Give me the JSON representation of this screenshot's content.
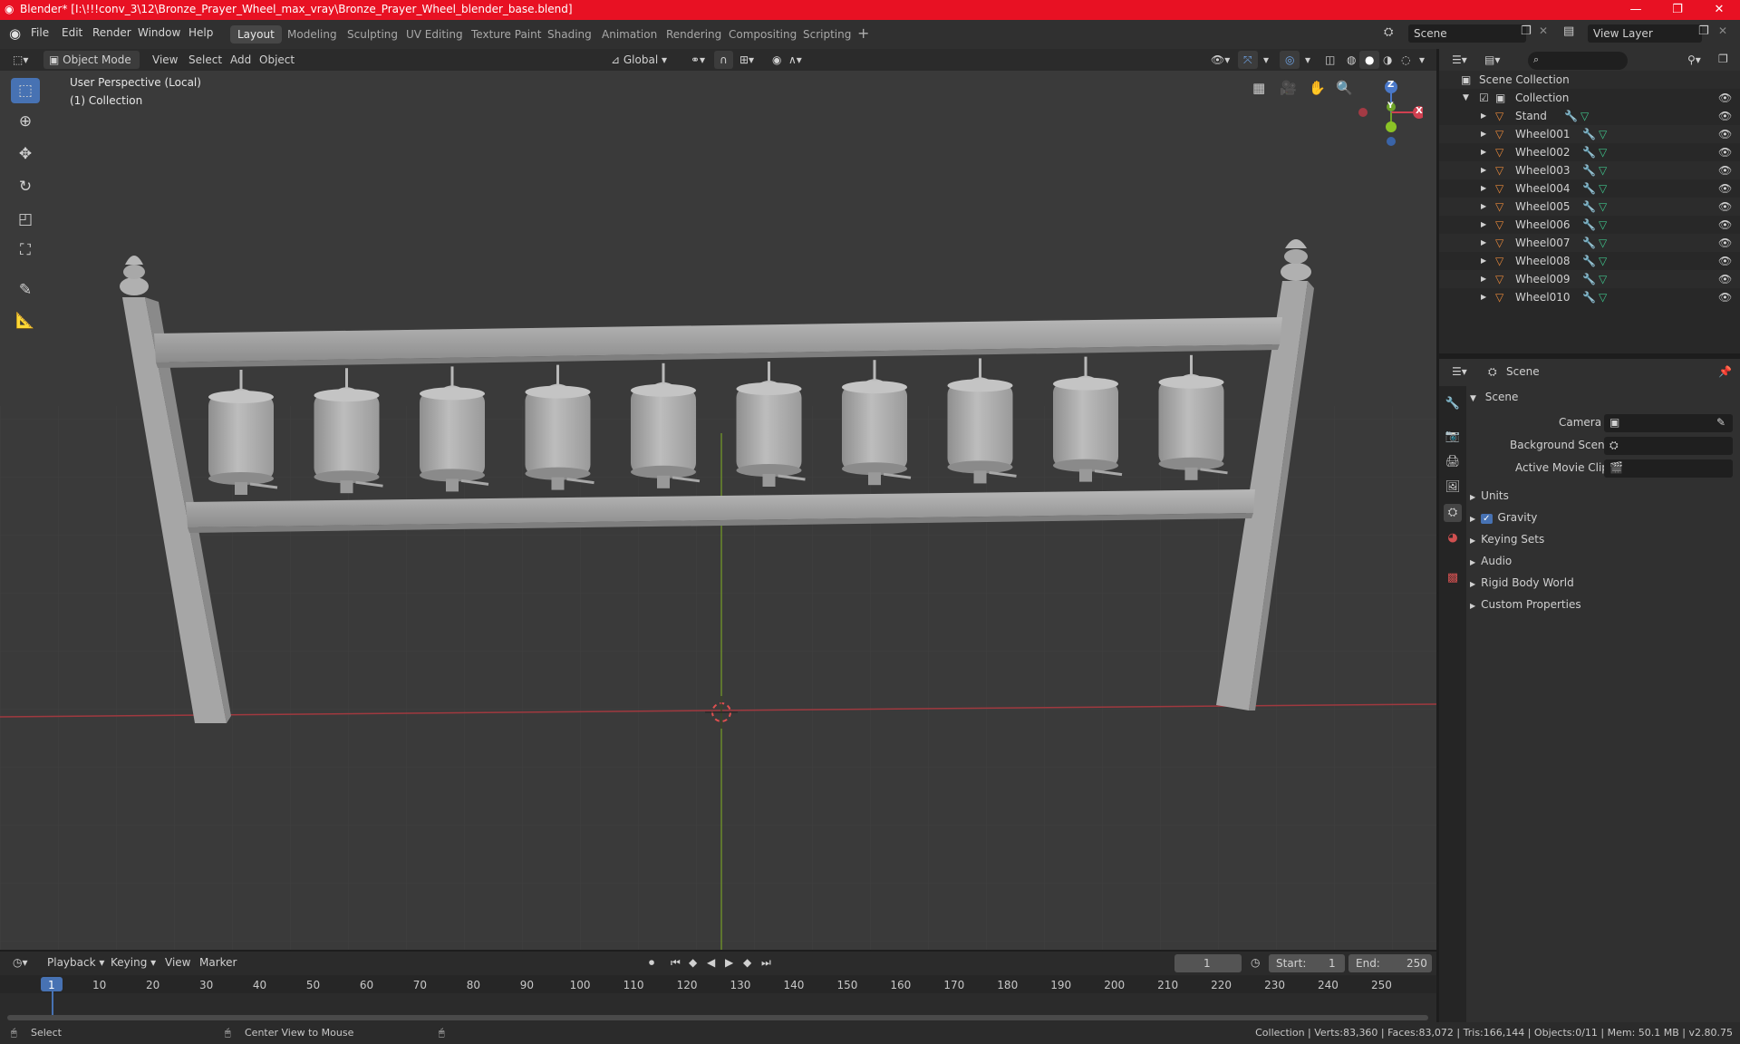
{
  "window": {
    "title": "Blender* [I:\\!!!conv_3\\12\\Bronze_Prayer_Wheel_max_vray\\Bronze_Prayer_Wheel_blender_base.blend]"
  },
  "menus": [
    "File",
    "Edit",
    "Render",
    "Window",
    "Help"
  ],
  "workspaces": [
    {
      "label": "Layout",
      "active": true
    },
    {
      "label": "Modeling"
    },
    {
      "label": "Sculpting"
    },
    {
      "label": "UV Editing"
    },
    {
      "label": "Texture Paint"
    },
    {
      "label": "Shading"
    },
    {
      "label": "Animation"
    },
    {
      "label": "Rendering"
    },
    {
      "label": "Compositing"
    },
    {
      "label": "Scripting"
    }
  ],
  "scene_name": "Scene",
  "view_layer": "View Layer",
  "viewport_header": {
    "mode": "Object Mode",
    "view": "View",
    "select": "Select",
    "add": "Add",
    "object": "Object",
    "orientation": "Global"
  },
  "viewport_overlay": {
    "perspective": "User Perspective (Local)",
    "collection": "(1) Collection"
  },
  "gizmo": {
    "z": "Z",
    "y": "Y",
    "x": "X"
  },
  "outliner": {
    "root": "Scene Collection",
    "collection": "Collection",
    "objects": [
      "Stand",
      "Wheel001",
      "Wheel002",
      "Wheel003",
      "Wheel004",
      "Wheel005",
      "Wheel006",
      "Wheel007",
      "Wheel008",
      "Wheel009",
      "Wheel010"
    ]
  },
  "properties": {
    "header": "Scene",
    "section": "Scene",
    "camera_label": "Camera",
    "background_scene_label": "Background Scene",
    "active_movie_clip_label": "Active Movie Clip",
    "subsections": [
      "Units",
      "Gravity",
      "Keying Sets",
      "Audio",
      "Rigid Body World",
      "Custom Properties"
    ]
  },
  "timeline": {
    "playback": "Playback",
    "keying": "Keying",
    "view": "View",
    "marker": "Marker",
    "current_frame": "1",
    "start_label": "Start:",
    "start": "1",
    "end_label": "End:",
    "end": "250",
    "ticks": [
      "1",
      "10",
      "20",
      "30",
      "40",
      "50",
      "60",
      "70",
      "80",
      "90",
      "100",
      "110",
      "120",
      "130",
      "140",
      "150",
      "160",
      "170",
      "180",
      "190",
      "200",
      "210",
      "220",
      "230",
      "240",
      "250"
    ]
  },
  "status": {
    "select": "Select",
    "center": "Center View to Mouse",
    "stats": "Collection | Verts:83,360 | Faces:83,072 | Tris:166,144 | Objects:0/11 | Mem: 50.1 MB | v2.80.75"
  },
  "colors": {
    "title_bar": "#e81123",
    "active_blue": "#4772b3",
    "object_orange": "#e8883a",
    "modifier_blue": "#6ea3e6",
    "mesh_green": "#3fc28a"
  }
}
